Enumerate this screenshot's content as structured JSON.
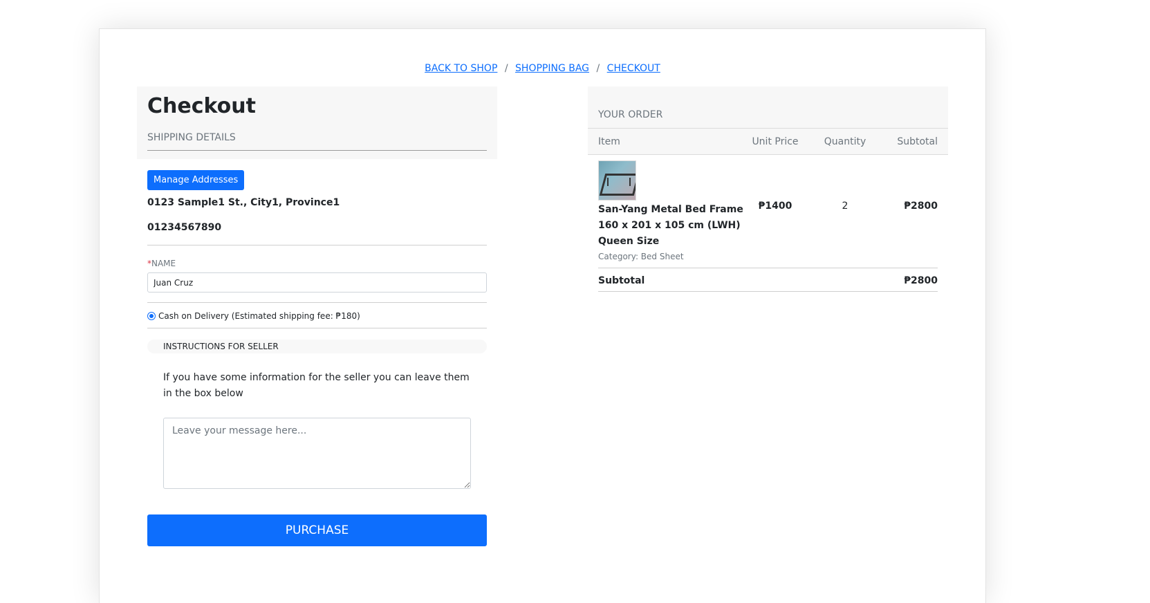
{
  "breadcrumb": {
    "back_to_shop": "BACK TO SHOP",
    "shopping_bag": "SHOPPING BAG",
    "checkout": "CHECKOUT",
    "separator": "/"
  },
  "checkout": {
    "title": "Checkout",
    "shipping_details": "SHIPPING DETAILS",
    "manage_addresses": "Manage Addresses",
    "address": "0123 Sample1 St., City1, Province1",
    "phone": "01234567890",
    "name_required_mark": "*",
    "name_label": "NAME",
    "name_value": "Juan Cruz",
    "payment_option": "Cash on Delivery (Estimated shipping fee: ₱180)",
    "instructions_title": "INSTRUCTIONS FOR SELLER",
    "instructions_text": "If you have some information for the seller you can leave them in the box below",
    "message_placeholder": "Leave your message here...",
    "purchase_button": "PURCHASE"
  },
  "order": {
    "title": "YOUR ORDER",
    "columns": [
      "Item",
      "Unit Price",
      "Quantity",
      "Subtotal"
    ],
    "items": [
      {
        "name": "San-Yang Metal Bed Frame 160 x 201 x 105 cm (LWH) Queen Size",
        "category": "Category: Bed Sheet",
        "unit_price": "₱1400",
        "quantity": "2",
        "subtotal": "₱2800"
      }
    ],
    "subtotal_label": "Subtotal",
    "subtotal_value": "₱2800"
  },
  "colors": {
    "primary": "#0d6efd",
    "required": "#dc3545",
    "muted": "#6c757d"
  }
}
